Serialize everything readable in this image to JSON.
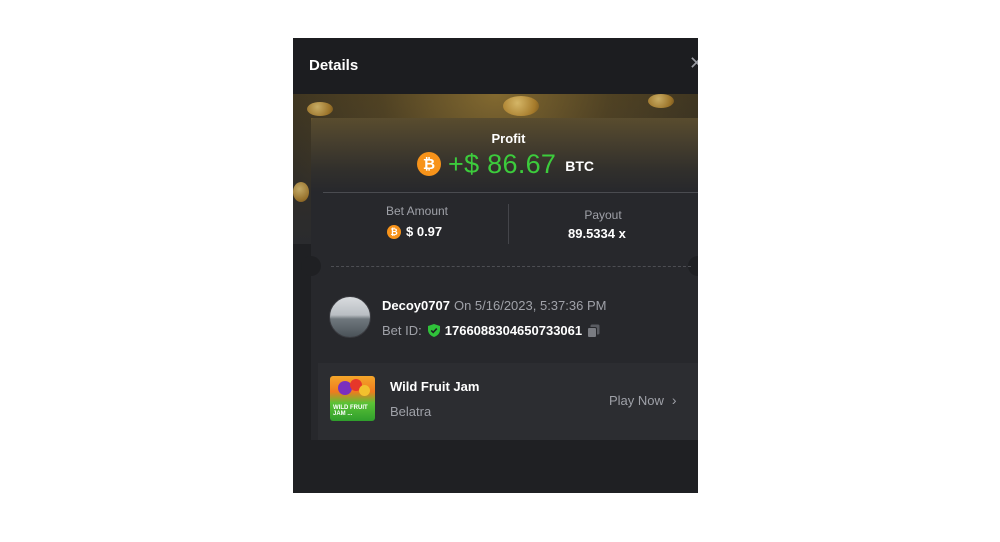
{
  "modal": {
    "title": "Details",
    "close_icon": "close-icon"
  },
  "profit": {
    "label": "Profit",
    "value": "+$ 86.67",
    "currency": "BTC",
    "currency_icon": "bitcoin-icon",
    "coin_glyph": "₿",
    "color": "#3ccc3c"
  },
  "bet": {
    "amount_label": "Bet Amount",
    "amount_value": "$ 0.97",
    "payout_label": "Payout",
    "payout_value": "89.5334 x"
  },
  "user": {
    "name": "Decoy0707",
    "timestamp": "On 5/16/2023, 5:37:36 PM",
    "bet_id_label": "Bet ID:",
    "bet_id": "1766088304650733061",
    "verified_icon": "shield-check-icon",
    "copy_icon": "copy-icon"
  },
  "game": {
    "name": "Wild Fruit Jam",
    "provider": "Belatra",
    "thumb_text": "WILD FRUIT JAM ...",
    "play_label": "Play Now",
    "play_icon": "chevron-right-icon",
    "chevron_glyph": "›"
  },
  "colors": {
    "accent_btc": "#f7931a",
    "background": "#1f2023"
  }
}
